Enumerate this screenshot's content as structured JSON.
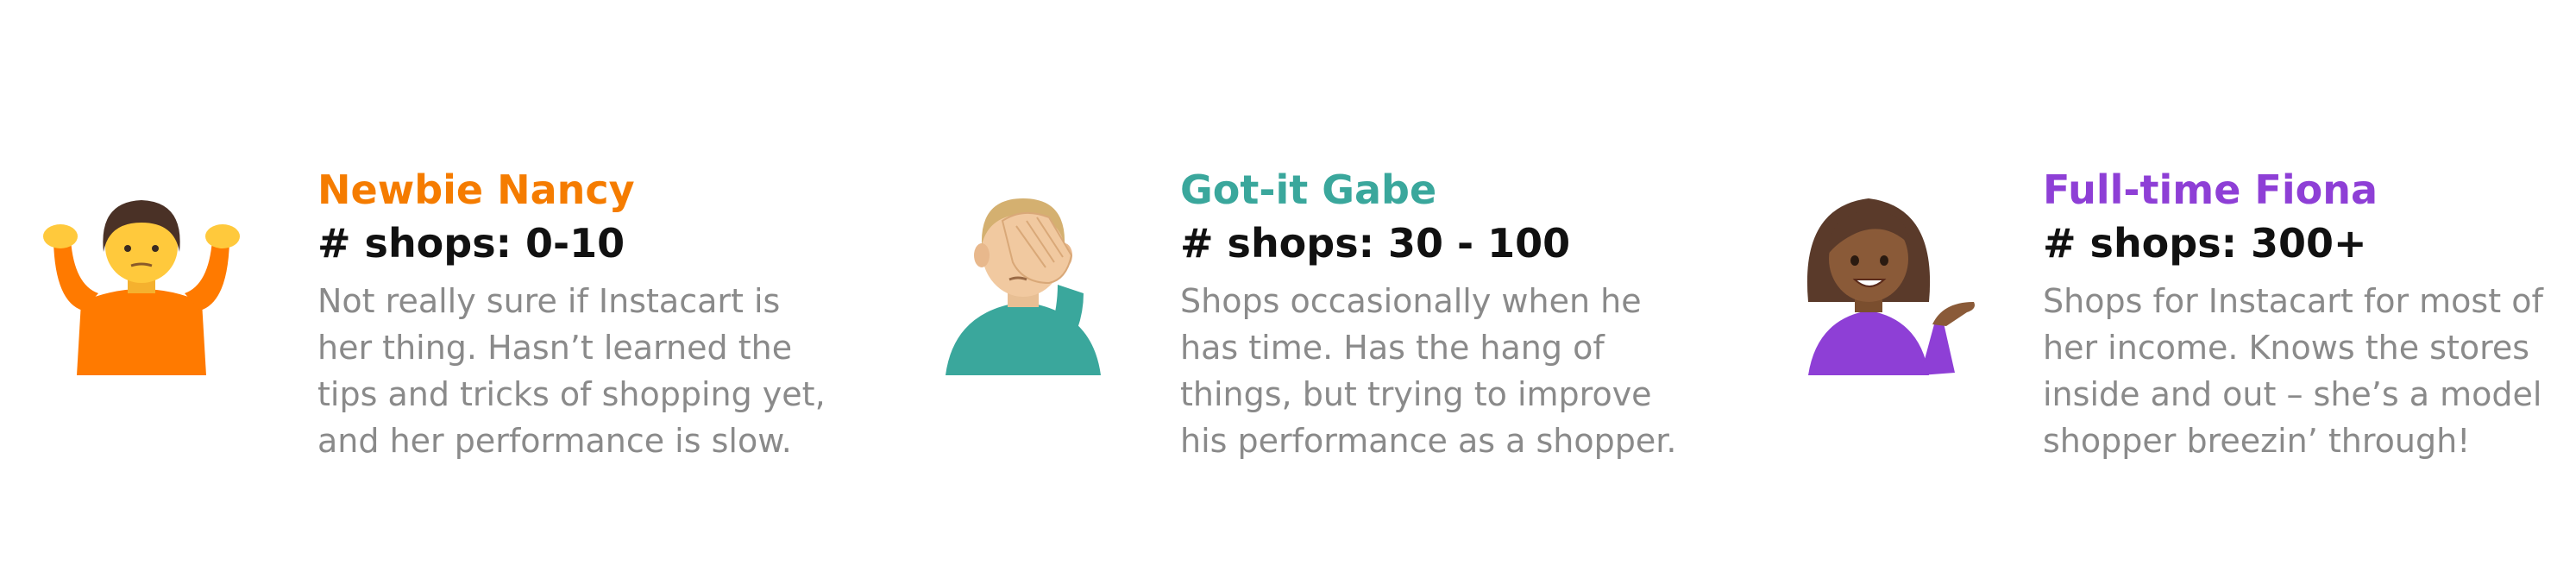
{
  "personas": [
    {
      "name": "Newbie Nancy",
      "shops": "# shops: 0-10",
      "description": [
        "Not really sure if Instacart is",
        "her thing. Hasn’t learned the",
        "tips and tricks of shopping yet,",
        "and her performance is slow."
      ],
      "accent_color": "#F57C00",
      "icon": "person-shrugging-icon"
    },
    {
      "name": "Got-it Gabe",
      "shops": "# shops: 30 - 100",
      "description": [
        "Shops occasionally when he",
        "has time. Has the hang of",
        "things, but trying to improve",
        "his performance as a shopper."
      ],
      "accent_color": "#3AA79C",
      "icon": "man-facepalming-icon"
    },
    {
      "name": "Full-time Fiona",
      "shops": "# shops: 300+",
      "description": [
        "Shops for Instacart for most of",
        "her income. Knows the stores",
        "inside and out – she’s a model",
        "shopper breezin’ through!"
      ],
      "accent_color": "#8E3FD6",
      "icon": "woman-tipping-hand-icon"
    }
  ]
}
